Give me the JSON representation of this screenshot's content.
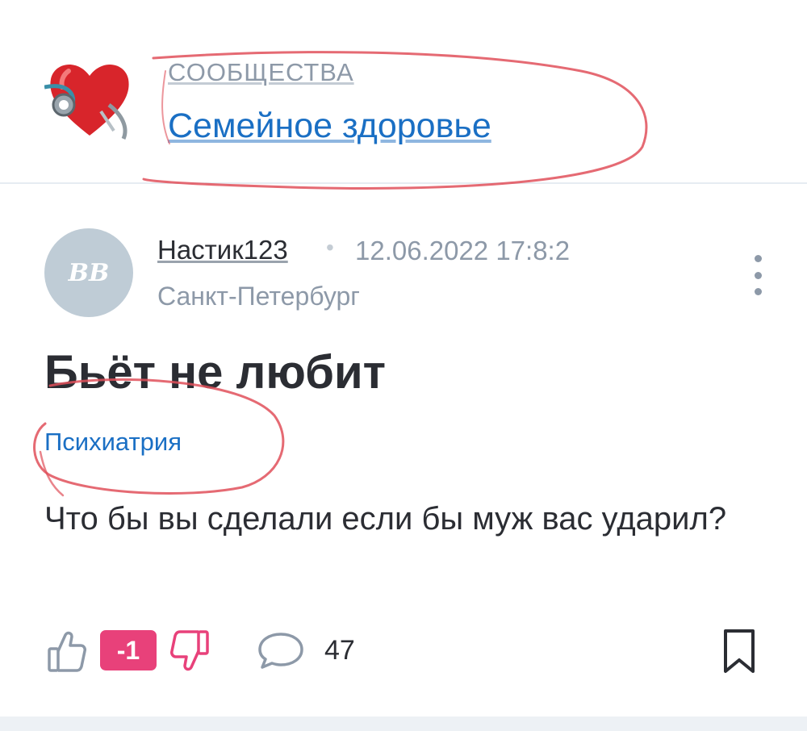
{
  "community": {
    "kicker": "СООБЩЕСТВА",
    "name": "Семейное здоровье",
    "avatar_icon": "heart-stethoscope-icon"
  },
  "post": {
    "author": {
      "initials": "BB",
      "name": "Настик123",
      "city": "Санкт-Петербург"
    },
    "separator": "•",
    "date": "12.06.2022 17:8:2",
    "title": "Бьёт не любит",
    "tag": "Психиатрия",
    "body": "Что бы вы сделали если бы муж вас ударил?"
  },
  "actions": {
    "score": "-1",
    "comment_count": "47",
    "icons": [
      "thumbs-up-icon",
      "thumbs-down-icon",
      "comment-icon",
      "bookmark-icon",
      "more-vertical-icon"
    ]
  },
  "colors": {
    "link": "#1a6fc4",
    "score_badge": "#e8417a",
    "muted_text": "#8d99a8",
    "annotation": "#e0505a"
  }
}
